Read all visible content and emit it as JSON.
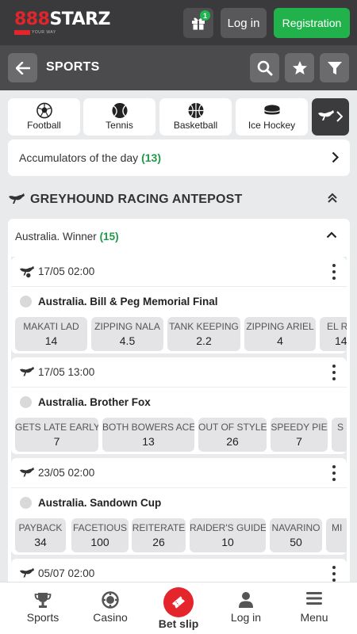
{
  "header": {
    "logo_text_accent": "888",
    "logo_text_main": "STARZ",
    "logo_tagline": "YOUR WAY",
    "gift_badge": "1",
    "login_label": "Log in",
    "register_label": "Registration"
  },
  "sports_bar": {
    "title": "SPORTS"
  },
  "categories": [
    {
      "label": "Football",
      "icon": "football-icon"
    },
    {
      "label": "Tennis",
      "icon": "tennis-icon"
    },
    {
      "label": "Basketball",
      "icon": "basketball-icon"
    },
    {
      "label": "Ice Hockey",
      "icon": "ice-hockey-icon"
    },
    {
      "label": "",
      "icon": "greyhound-icon"
    }
  ],
  "accumulators": {
    "label": "Accumulators of the day",
    "count": "(13)"
  },
  "section": {
    "title": "GREYHOUND RACING ANTEPOST"
  },
  "league": {
    "label": "Australia. Winner",
    "count": "(15)"
  },
  "events": [
    {
      "time": "17/05 02:00",
      "name": "Australia. Bill & Peg Memorial Final",
      "odds": [
        {
          "label": "MAKATI LAD",
          "value": "14"
        },
        {
          "label": "ZIPPING NALA",
          "value": "4.5"
        },
        {
          "label": "TANK KEEPING",
          "value": "2.2"
        },
        {
          "label": "ZIPPING ARIEL",
          "value": "4"
        },
        {
          "label": "EL RE",
          "value": "14"
        }
      ]
    },
    {
      "time": "17/05 13:00",
      "name": "Australia. Brother Fox",
      "odds": [
        {
          "label": "GETS LATE EARLY",
          "value": "7"
        },
        {
          "label": "BOTH BOWERS ACE",
          "value": "13"
        },
        {
          "label": "OUT OF STYLE",
          "value": "26"
        },
        {
          "label": "SPEEDY PIE",
          "value": "7"
        },
        {
          "label": "S",
          "value": ""
        }
      ]
    },
    {
      "time": "23/05 02:00",
      "name": "Australia. Sandown Cup",
      "odds": [
        {
          "label": "PAYBACK",
          "value": "34"
        },
        {
          "label": "FACETIOUS",
          "value": "100"
        },
        {
          "label": "REITERATE",
          "value": "26"
        },
        {
          "label": "RAIDER'S GUIDE",
          "value": "10"
        },
        {
          "label": "NAVARINO",
          "value": "50"
        },
        {
          "label": "MI",
          "value": ""
        }
      ]
    },
    {
      "time": "05/07 02:00",
      "name": "",
      "odds": []
    }
  ],
  "bottom_nav": [
    {
      "label": "Sports",
      "icon": "trophy-icon"
    },
    {
      "label": "Casino",
      "icon": "casino-chip-icon"
    },
    {
      "label": "Bet slip",
      "icon": "ticket-icon"
    },
    {
      "label": "Log in",
      "icon": "user-icon"
    },
    {
      "label": "Menu",
      "icon": "menu-icon"
    }
  ],
  "colors": {
    "accent_green": "#22b24c",
    "count_green": "#1e9a45",
    "bet_slip_red": "#e4262c",
    "header_dark": "#3a3a3c",
    "sports_bar": "#4b4b4d"
  }
}
